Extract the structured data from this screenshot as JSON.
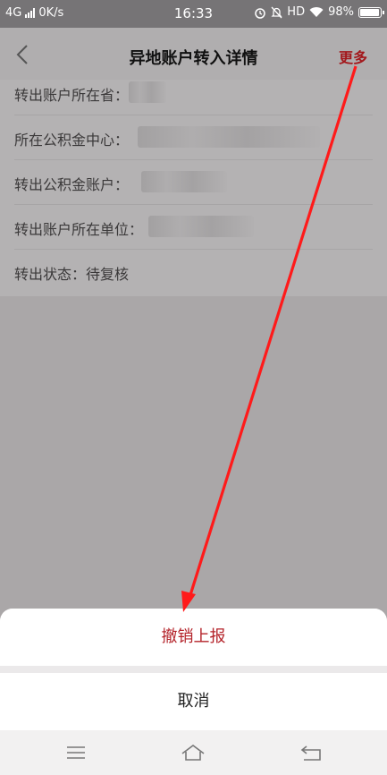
{
  "status_bar": {
    "network": "4G",
    "speed": "0K/s",
    "time": "16:33",
    "hd": "HD",
    "battery": "98%"
  },
  "header": {
    "title": "异地账户转入详情",
    "more_label": "更多"
  },
  "info_rows": [
    {
      "label": "转出账户所在省："
    },
    {
      "label": "所在公积金中心："
    },
    {
      "label": "转出公积金账户："
    },
    {
      "label": "转出账户所在单位："
    },
    {
      "label": "转出状态：待复核"
    }
  ],
  "action_sheet": {
    "primary_label": "撤销上报",
    "cancel_label": "取消"
  },
  "colors": {
    "accent": "#b4232a",
    "arrow": "#ff1a1a"
  },
  "nav_icons": [
    "menu-icon",
    "home-icon",
    "back-icon"
  ]
}
